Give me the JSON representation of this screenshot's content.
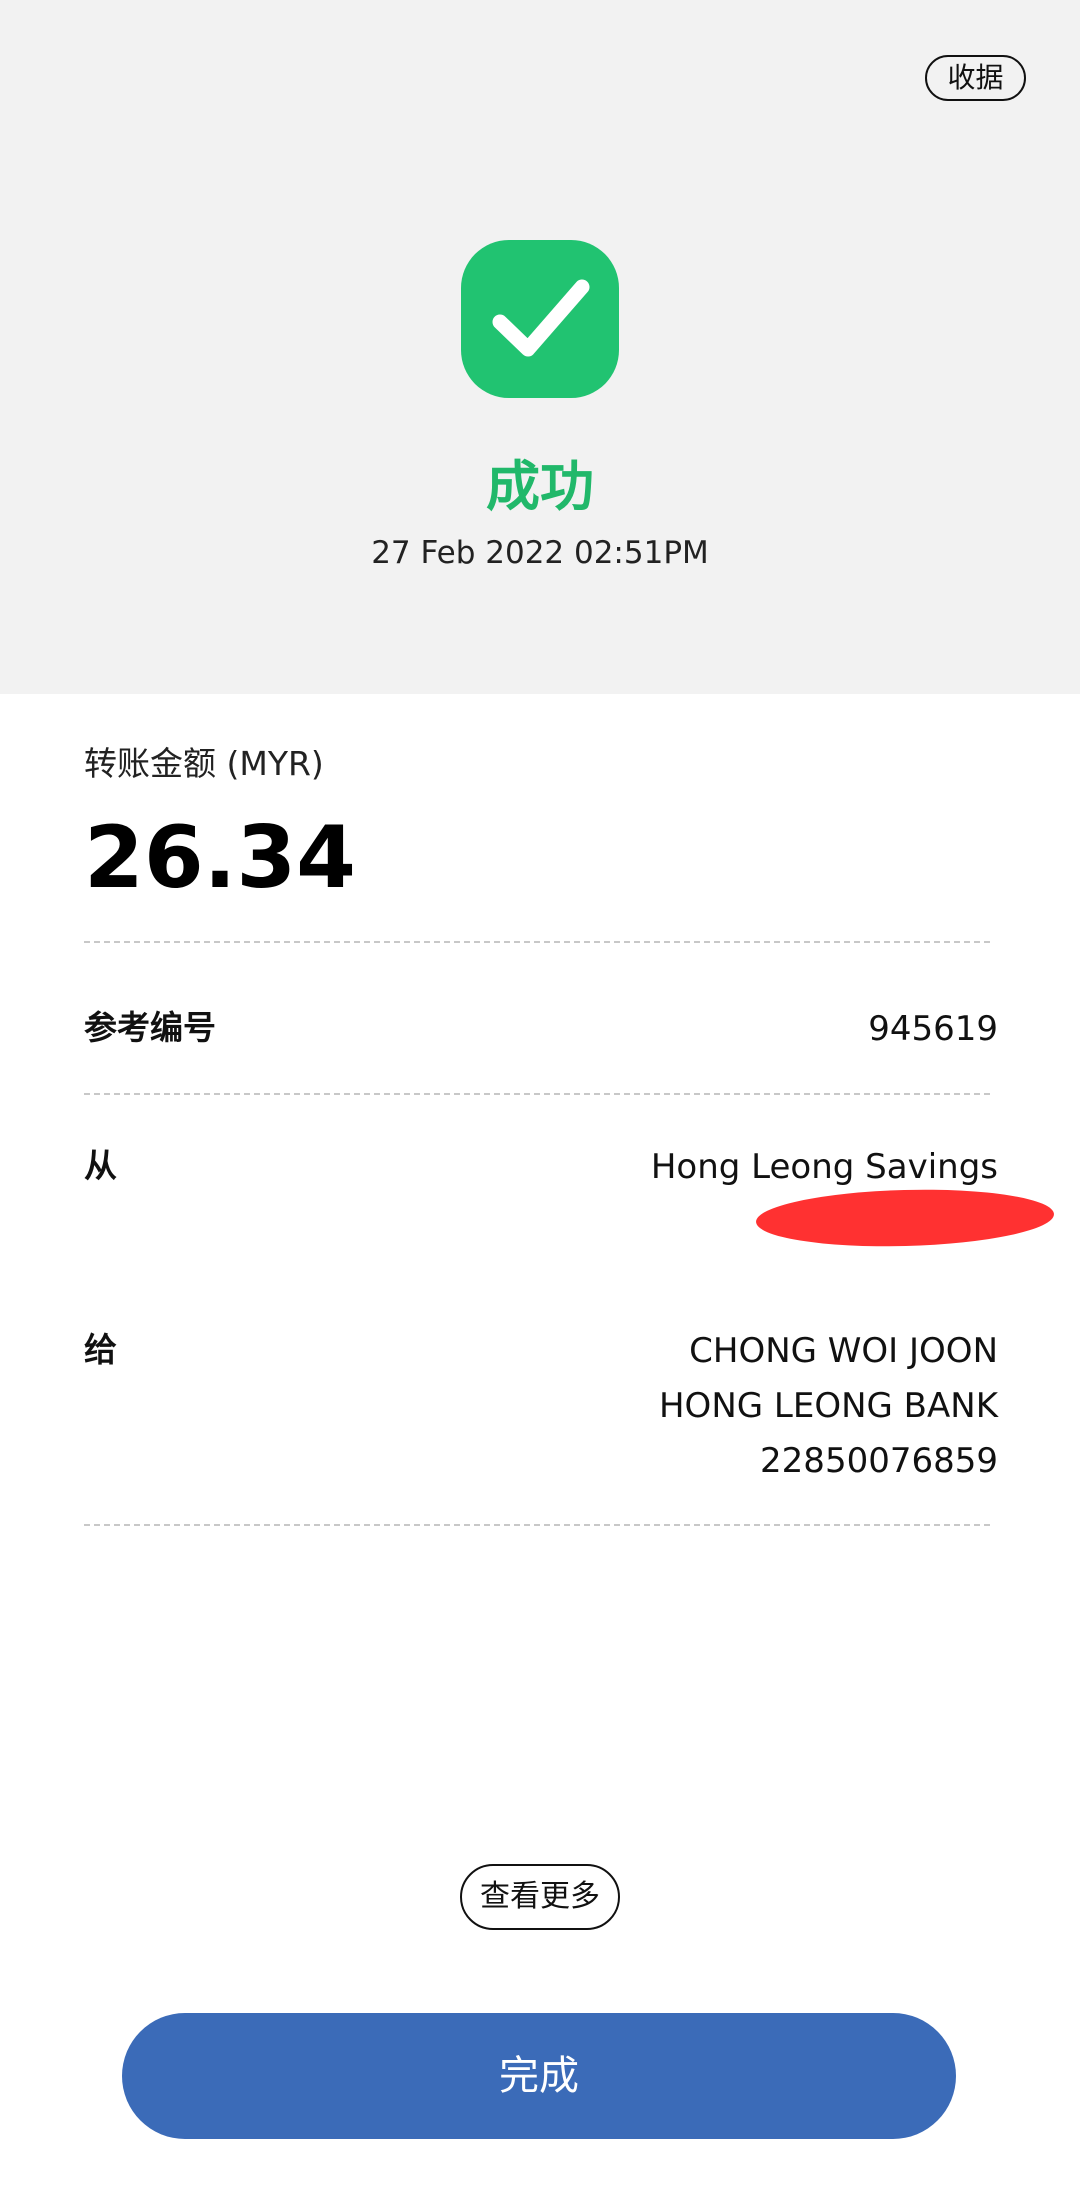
{
  "header": {
    "receipt_label": "收据",
    "status_text": "成功",
    "datetime": "27 Feb 2022 02:51PM"
  },
  "amount": {
    "label": "转账金额 (MYR)",
    "value": "26.34"
  },
  "reference": {
    "label": "参考编号",
    "value": "945619"
  },
  "from": {
    "label": "从",
    "account_name": "Hong Leong Savings"
  },
  "to": {
    "label": "给",
    "name": "CHONG WOI JOON",
    "bank": "HONG LEONG BANK",
    "account_number": "22850076859"
  },
  "actions": {
    "more_label": "查看更多",
    "done_label": "完成"
  },
  "colors": {
    "success": "#21c371",
    "primary": "#3b6bb8",
    "redaction": "#ff3131",
    "header_bg": "#f2f2f2"
  },
  "icons": {
    "status": "check-icon"
  }
}
